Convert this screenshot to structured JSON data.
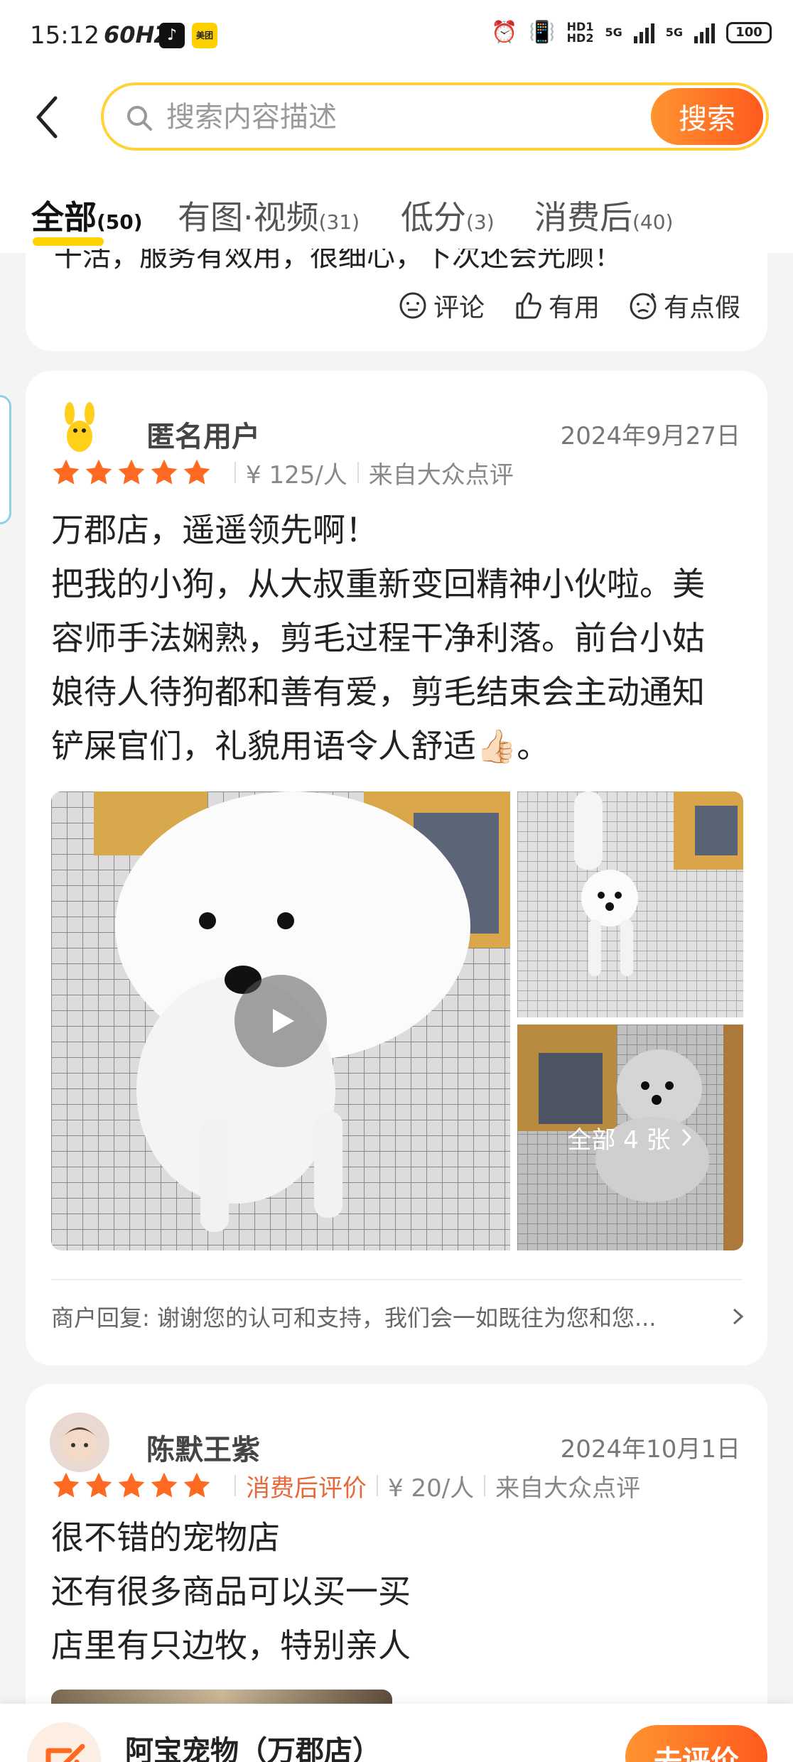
{
  "status_bar": {
    "time": "15:12",
    "refresh": "60HZ",
    "app1": "♪",
    "app2": "美团",
    "net1": "HD1",
    "net2": "HD2",
    "sim1": "5G",
    "sim2": "5G",
    "battery": "100"
  },
  "search": {
    "placeholder": "搜索内容描述",
    "button_label": "搜索"
  },
  "tabs": [
    {
      "label": "全部",
      "count": "(50)"
    },
    {
      "label": "有图·视频",
      "count": "(31)"
    },
    {
      "label": "低分",
      "count": "(3)"
    },
    {
      "label": "消费后",
      "count": "(40)"
    }
  ],
  "prev_review": {
    "partial_text": "干活，服务有效用，很细心，下次还会光顾！",
    "actions": {
      "comment": "评论",
      "useful": "有用",
      "fake": "有点假"
    }
  },
  "reviews": [
    {
      "user": "匿名用户",
      "date": "2024年9月27日",
      "rating": 5,
      "price": "¥ 125/人",
      "source": "来自大众点评",
      "lines": [
        "万郡店，遥遥领先啊！",
        "把我的小狗，从大叔重新变回精神小伙啦。美",
        "容师手法娴熟，剪毛过程干净利落。前台小姑",
        "娘待人待狗都和善有爱，剪毛结束会主动通知",
        "铲屎官们，礼貌用语令人舒适👍🏻。"
      ],
      "photos_label": "全部 4 张",
      "merchant_reply": "商户回复: 谢谢您的认可和支持，我们会一如既往为您和您..."
    },
    {
      "user": "陈默王紫",
      "date": "2024年10月1日",
      "rating": 5,
      "tag": "消费后评价",
      "price": "¥ 20/人",
      "source": "来自大众点评",
      "lines": [
        "很不错的宠物店",
        "还有很多商品可以买一买",
        "店里有只边牧，特别亲人"
      ]
    }
  ],
  "bottom_bar": {
    "shop_name": "阿宝宠物（万郡店）",
    "review_button": "去评价"
  },
  "colors": {
    "accent": "#ff6a22",
    "search_border": "#ffd23c",
    "tab_underline": "#ffd200",
    "star": "#ff6a22"
  }
}
